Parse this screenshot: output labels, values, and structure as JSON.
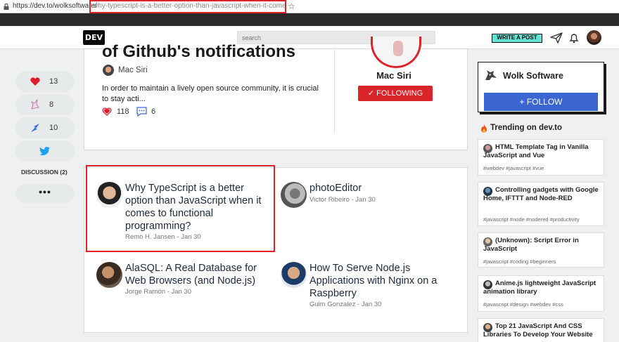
{
  "browser": {
    "url_host": "https://dev.to/wolksoftware/",
    "url_path": "why-typescript-is-a-better-option-than-javascript-when-it-comes-t..."
  },
  "header": {
    "logo": "DEV",
    "search_placeholder": "search",
    "write_label": "WRITE A POST"
  },
  "reactions": [
    {
      "icon": "heart-icon",
      "count": "13"
    },
    {
      "icon": "unicorn-icon",
      "count": "8"
    },
    {
      "icon": "bookmark-icon",
      "count": "10"
    },
    {
      "icon": "twitter-icon",
      "count": ""
    }
  ],
  "discussion_label": "DISCUSSION (2)",
  "more_label": "•••",
  "top_article": {
    "title": "of Github's notifications",
    "author": "Mac Siri",
    "description": "In order to maintain a lively open source community, it is crucial to stay acti...",
    "likes": "118",
    "comments": "6"
  },
  "author_card": {
    "name": "Mac Siri",
    "follow_label": "✓ FOLLOWING"
  },
  "articles": [
    {
      "title": "Why TypeScript is a better option than JavaScript when it comes to functional programming?",
      "meta": "Remo H. Jansen - Jan 30"
    },
    {
      "title": "photoEditor",
      "meta": "Victor Ribeiro - Jan 30"
    },
    {
      "title": "AlaSQL: A Real Database for Web Browsers (and Node.js)",
      "meta": "Jorge Ramón - Jan 30"
    },
    {
      "title": "How To Serve Node.js Applications with Nginx on a Raspberry",
      "meta": "Guim Gonzalez - Jan 30"
    }
  ],
  "org": {
    "name": "Wolk Software",
    "follow_label": "+ FOLLOW"
  },
  "trending_title": "Trending on dev.to",
  "trending": [
    {
      "title": "HTML Template Tag in Vanilla JavaScript and Vue",
      "tags": "#webdev #javascript #vue"
    },
    {
      "title": "Controlling gadgets with Google Home, IFTTT and Node-RED",
      "tags": "#javascript #node #nodered #productivity"
    },
    {
      "title": "(Unknown): Script Error in JavaScript",
      "tags": "#javascript #coding #beginners"
    },
    {
      "title": "Anime.js lightweight JavaScript animation library",
      "tags": "#javascript #design #webdev #css"
    },
    {
      "title": "Top 21 JavaScript And CSS Libraries To Develop Your Website",
      "tags": ""
    }
  ],
  "colors": {
    "accent_red": "#d9242a",
    "follow_blue": "#3b66d1",
    "write_teal": "#66e2d5"
  }
}
